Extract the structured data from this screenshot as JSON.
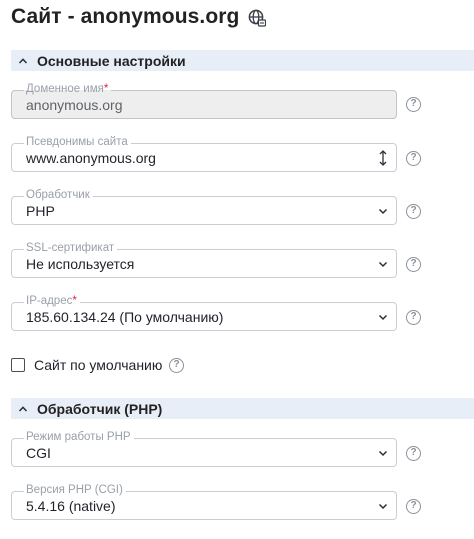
{
  "page": {
    "title": "Сайт - anonymous.org",
    "title_icon": "globe-icon"
  },
  "sections": {
    "basic": {
      "label": "Основные настройки",
      "icon": "chevron-up-icon",
      "expanded": true
    },
    "handler": {
      "label": "Обработчик (PHP)",
      "icon": "chevron-up-icon",
      "expanded": true
    }
  },
  "fields": {
    "domain": {
      "label": "Доменное имя",
      "required_mark": "*",
      "value": "anonymous.org",
      "disabled": true
    },
    "aliases": {
      "label": "Псевдонимы сайта",
      "value": "www.anonymous.org",
      "icon": "resize-updown-icon"
    },
    "handler": {
      "label": "Обработчик",
      "value": "PHP",
      "icon": "chevron-down-icon"
    },
    "ssl": {
      "label": "SSL-сертификат",
      "value": "Не используется",
      "icon": "chevron-down-icon"
    },
    "ip": {
      "label": "IP-адрес",
      "required_mark": "*",
      "value": "185.60.134.24 (По умолчанию)",
      "icon": "chevron-down-icon"
    },
    "php_mode": {
      "label": "Режим работы PHP",
      "value": "CGI",
      "icon": "chevron-down-icon"
    },
    "php_version": {
      "label": "Версия PHP (CGI)",
      "value": "5.4.16 (native)",
      "icon": "chevron-down-icon"
    }
  },
  "default_site": {
    "label": "Сайт по умолчанию",
    "checked": false
  },
  "help": {
    "symbol": "?",
    "icon": "help-circle-icon"
  },
  "colors": {
    "section_bg": "#e8eef7",
    "field_border": "#c9ced6",
    "legend": "#9aa0a8",
    "required": "#e0243a",
    "disabled_bg": "#eeeeee"
  }
}
